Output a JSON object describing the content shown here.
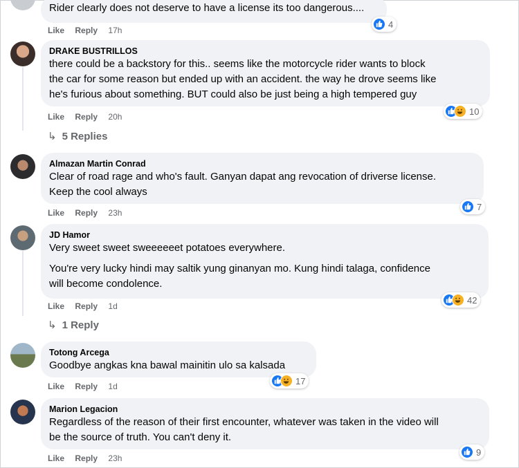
{
  "actions": {
    "like": "Like",
    "reply": "Reply"
  },
  "comments": [
    {
      "author": "",
      "lines": [
        "Rider clearly does not deserve to have a license its too dangerous...."
      ],
      "time": "17h",
      "reactions": "4"
    },
    {
      "author": "DRAKE BUSTRILLOS",
      "lines": [
        "there could be a backstory for this.. seems like the motorcycle rider wants to block\nthe car for some reason but ended up with an accident. the way he drove seems like\nhe's furious about something. BUT could also be just being a high tempered guy"
      ],
      "time": "20h",
      "reactions": "10",
      "replies": "5 Replies"
    },
    {
      "author": "Almazan Martin Conrad",
      "lines": [
        "Clear of road rage and who's fault. Ganyan dapat ang revocation of driverse license.\nKeep the cool always"
      ],
      "time": "23h",
      "reactions": "7"
    },
    {
      "author": "JD Hamor",
      "lines": [
        "Very sweet sweet sweeeeeet potatoes everywhere.",
        "You're very lucky hindi may saltik yung ginanyan mo. Kung hindi talaga, confidence\nwill become condolence."
      ],
      "time": "1d",
      "reactions": "42",
      "replies": "1 Reply"
    },
    {
      "author": "Totong Arcega",
      "lines": [
        "Goodbye angkas kna bawal mainitin ulo sa kalsada"
      ],
      "time": "1d",
      "reactions": "17"
    },
    {
      "author": "Marion Legacion",
      "lines": [
        "Regardless of the reason of their first encounter, whatever was taken in the video will\nbe the source of truth. You can't deny it."
      ],
      "time": "23h",
      "reactions": "9"
    }
  ],
  "colors": {
    "like": "#1877f2",
    "haha": "#f7b125",
    "bubble": "#f0f2f5",
    "meta": "#65676b"
  }
}
